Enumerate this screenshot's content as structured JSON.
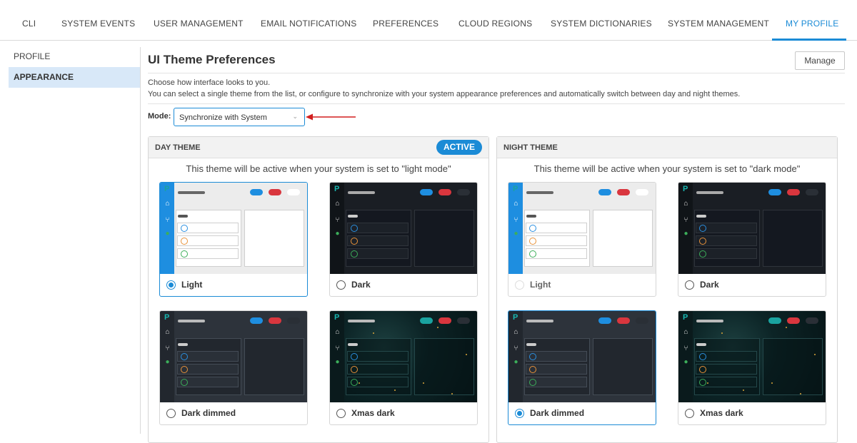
{
  "nav": {
    "tabs": [
      "CLI",
      "SYSTEM EVENTS",
      "USER MANAGEMENT",
      "EMAIL NOTIFICATIONS",
      "PREFERENCES",
      "CLOUD REGIONS",
      "SYSTEM DICTIONARIES",
      "SYSTEM MANAGEMENT",
      "MY PROFILE"
    ],
    "active": "MY PROFILE"
  },
  "sidebar": {
    "items": [
      "PROFILE",
      "APPEARANCE"
    ],
    "selected": "APPEARANCE"
  },
  "main": {
    "title": "UI Theme Preferences",
    "manage_label": "Manage",
    "desc1": "Choose how interface looks to you.",
    "desc2": "You can select a single theme from the list, or configure to synchronize with your system appearance preferences and automatically switch between day and night themes.",
    "mode_label": "Mode:",
    "mode_value": "Synchronize with System"
  },
  "day_theme": {
    "title": "DAY THEME",
    "badge": "ACTIVE",
    "note": "This theme will be active when your system is set to \"light mode\"",
    "options": [
      "Light",
      "Dark",
      "Dark dimmed",
      "Xmas dark"
    ],
    "selected": "Light"
  },
  "night_theme": {
    "title": "NIGHT THEME",
    "note": "This theme will be active when your system is set to \"dark mode\"",
    "options": [
      "Light",
      "Dark",
      "Dark dimmed",
      "Xmas dark"
    ],
    "selected": "Dark dimmed",
    "disabled": [
      "Light"
    ]
  },
  "icons": {
    "logo": "P",
    "home": "⌂",
    "fork": "⑂",
    "run": "●"
  },
  "colors": {
    "accent": "#1b8bd6",
    "pill_blue": "#1e8ee0",
    "pill_red": "#d9363e",
    "status_blue": "#2b8fe0",
    "status_orange": "#e8923a",
    "status_green": "#3cae5a",
    "teal": "#1aa3a0"
  }
}
